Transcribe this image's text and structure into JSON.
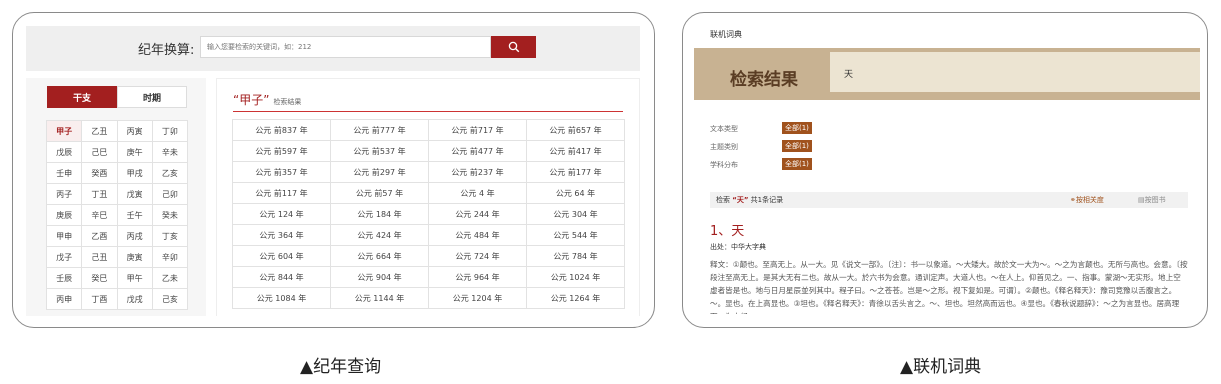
{
  "colors": {
    "accent": "#a31f1f",
    "chip": "#a0521d",
    "banner": "#c8b292"
  },
  "panel1": {
    "search_title": "纪年换算:",
    "search_placeholder": "输入您要检索的关键词，如：212",
    "search_icon": "search-icon",
    "tabs": [
      "干支",
      "时期"
    ],
    "ganzhi_rows": [
      [
        "甲子",
        "乙丑",
        "丙寅",
        "丁卯"
      ],
      [
        "戊辰",
        "己巳",
        "庚午",
        "辛未"
      ],
      [
        "壬申",
        "癸酉",
        "甲戌",
        "乙亥"
      ],
      [
        "丙子",
        "丁丑",
        "戊寅",
        "己卯"
      ],
      [
        "庚辰",
        "辛巳",
        "壬午",
        "癸未"
      ],
      [
        "甲申",
        "乙酉",
        "丙戌",
        "丁亥"
      ],
      [
        "戊子",
        "己丑",
        "庚寅",
        "辛卯"
      ],
      [
        "壬辰",
        "癸巳",
        "甲午",
        "乙未"
      ],
      [
        "丙申",
        "丁酉",
        "戊戌",
        "己亥"
      ]
    ],
    "result_title": "“甲子”",
    "result_subtitle": "检索结果",
    "year_rows": [
      [
        "公元 前837 年",
        "公元 前777 年",
        "公元 前717 年",
        "公元 前657 年"
      ],
      [
        "公元 前597 年",
        "公元 前537 年",
        "公元 前477 年",
        "公元 前417 年"
      ],
      [
        "公元 前357 年",
        "公元 前297 年",
        "公元 前237 年",
        "公元 前177 年"
      ],
      [
        "公元 前117 年",
        "公元 前57 年",
        "公元 4 年",
        "公元 64 年"
      ],
      [
        "公元 124 年",
        "公元 184 年",
        "公元 244 年",
        "公元 304 年"
      ],
      [
        "公元 364 年",
        "公元 424 年",
        "公元 484 年",
        "公元 544 年"
      ],
      [
        "公元 604 年",
        "公元 664 年",
        "公元 724 年",
        "公元 784 年"
      ],
      [
        "公元 844 年",
        "公元 904 年",
        "公元 964 年",
        "公元 1024 年"
      ],
      [
        "公元 1084 年",
        "公元 1144 年",
        "公元 1204 年",
        "公元 1264 年"
      ]
    ],
    "caption": "▲纪年查询"
  },
  "panel2": {
    "header": "联机词典",
    "banner_title": "检索结果",
    "query": "天",
    "filters": [
      {
        "label": "文本类型",
        "chip": "全部(1)"
      },
      {
        "label": "主题类别",
        "chip": "全部(1)"
      },
      {
        "label": "学科分布",
        "chip": "全部(1)"
      }
    ],
    "results_prefix": "检索",
    "results_term": "“天”",
    "results_suffix": "共1条记录",
    "sort_relevance": "按相关度",
    "sort_book": "按图书",
    "entry": "1、天",
    "source": "出处：中华大字典",
    "body": "释文：①颠也。至高无上。从一大。见《说文一部》。〔注〕：书一以象道。～大矮大。故於文一大为～。～之为言颠也。无所与高也。会意。〔按段注至高无上。是其大无有二也。故从一大。於六书为会意。通训定声。大道人也。～在人上。仰首见之。一、指事。蒙湖～无实形。地上空虚者皆是也。地与日月星辰並列其中。程子曰。～之苍苍。岂是～之形。视下复如是。可谓〕。②颠也。《释名释天》：豫司竞豫以舌腹言之。～。显也。在上高显也。③坦也。《释名释天》：青徐以舌头言之。～、坦也。坦然高而远也。④显也。《春秋说题辞》：～之为言显也。居高理下。为人经",
    "caption": "▲联机词典"
  }
}
